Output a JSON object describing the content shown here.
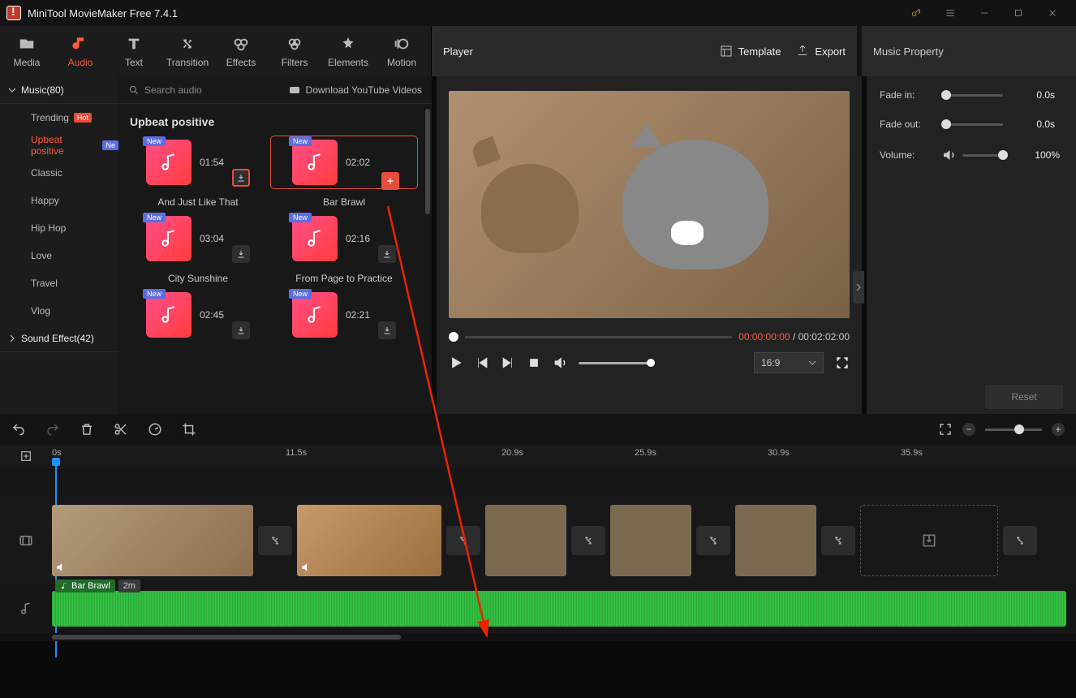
{
  "app": {
    "title": "MiniTool MovieMaker Free 7.4.1"
  },
  "tabs": {
    "media": "Media",
    "audio": "Audio",
    "text": "Text",
    "transition": "Transition",
    "effects": "Effects",
    "filters": "Filters",
    "elements": "Elements",
    "motion": "Motion"
  },
  "sidebar": {
    "music_group": "Music(80)",
    "sound_group": "Sound Effect(42)",
    "categories": [
      "Trending",
      "Upbeat positive",
      "Classic",
      "Happy",
      "Hip Hop",
      "Love",
      "Travel",
      "Vlog"
    ],
    "hot_badge": "Hot",
    "new_badge": "Ne"
  },
  "browser": {
    "search_placeholder": "Search audio",
    "download_yt": "Download YouTube Videos",
    "section_title": "Upbeat positive",
    "tracks": [
      {
        "name": "And Just Like That",
        "dur": "01:54"
      },
      {
        "name": "Bar Brawl",
        "dur": "02:02"
      },
      {
        "name": "City Sunshine",
        "dur": "03:04"
      },
      {
        "name": "From Page to Practice",
        "dur": "02:16"
      },
      {
        "name": "",
        "dur": "02:45"
      },
      {
        "name": "",
        "dur": "02:21"
      }
    ]
  },
  "player": {
    "title": "Player",
    "template": "Template",
    "export": "Export",
    "time_current": "00:00:00:00",
    "time_sep": " / ",
    "time_total": "00:02:02:00",
    "aspect": "16:9"
  },
  "properties": {
    "panel_title": "Music Property",
    "fade_in_label": "Fade in:",
    "fade_in_val": "0.0s",
    "fade_out_label": "Fade out:",
    "fade_out_val": "0.0s",
    "volume_label": "Volume:",
    "volume_val": "100%",
    "reset": "Reset"
  },
  "timeline": {
    "ticks": [
      "0s",
      "11.5s",
      "20.9s",
      "25.9s",
      "30.9s",
      "35.9s"
    ],
    "audio_clip_name": "Bar Brawl",
    "audio_clip_dur": "2m"
  }
}
